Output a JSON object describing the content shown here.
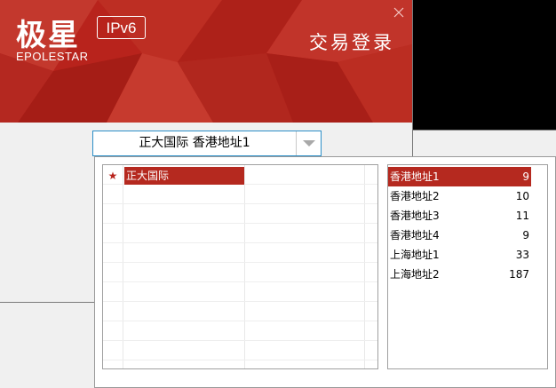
{
  "header": {
    "logo_cn": "极星",
    "logo_en": "EPOLESTAR",
    "badge": "IPv6",
    "title": "交易登录"
  },
  "combo": {
    "selected": "正大国际  香港地址1"
  },
  "brokers": [
    {
      "name": "正大国际",
      "starred": true,
      "star_icon": "★"
    }
  ],
  "servers": [
    {
      "name": "香港地址1",
      "value": "9"
    },
    {
      "name": "香港地址2",
      "value": "10"
    },
    {
      "name": "香港地址3",
      "value": "11"
    },
    {
      "name": "香港地址4",
      "value": "9"
    },
    {
      "name": "上海地址1",
      "value": "33"
    },
    {
      "name": "上海地址2",
      "value": "187"
    }
  ],
  "selected_server_index": 0,
  "colors": {
    "accent": "#b5291f",
    "combo_border": "#2c8fc8"
  }
}
